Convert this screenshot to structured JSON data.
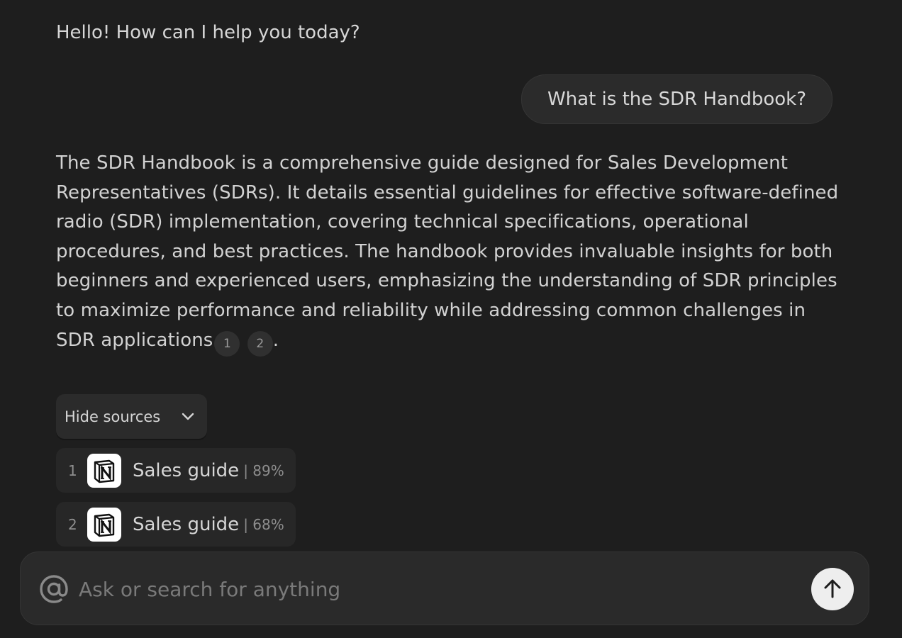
{
  "chat": {
    "greeting": "Hello! How can I help you today?",
    "user_message": "What is the SDR Handbook?",
    "answer_text": "The SDR Handbook is a comprehensive guide designed for Sales Development Representatives (SDRs). It details essential guidelines for effective software-defined radio (SDR) implementation, covering technical specifications, operational procedures, and best practices. The handbook provides invaluable insights for both beginners and experienced users, emphasizing the understanding of SDR principles to maximize performance and reliability while addressing common challenges in SDR applications",
    "citations": [
      "1",
      "2"
    ],
    "answer_end": "."
  },
  "sources": {
    "toggle_label": "Hide sources",
    "items": [
      {
        "num": "1",
        "title": "Sales guide",
        "score": "| 89%",
        "icon": "notion-icon"
      },
      {
        "num": "2",
        "title": "Sales guide",
        "score": "| 68%",
        "icon": "notion-icon"
      }
    ]
  },
  "composer": {
    "placeholder": "Ask or search for anything",
    "mention_icon": "at-icon",
    "send_icon": "arrow-up-icon"
  },
  "colors": {
    "background": "#1e1e1e",
    "bubble": "#2b2b2b",
    "send_button": "#eeeeee"
  }
}
